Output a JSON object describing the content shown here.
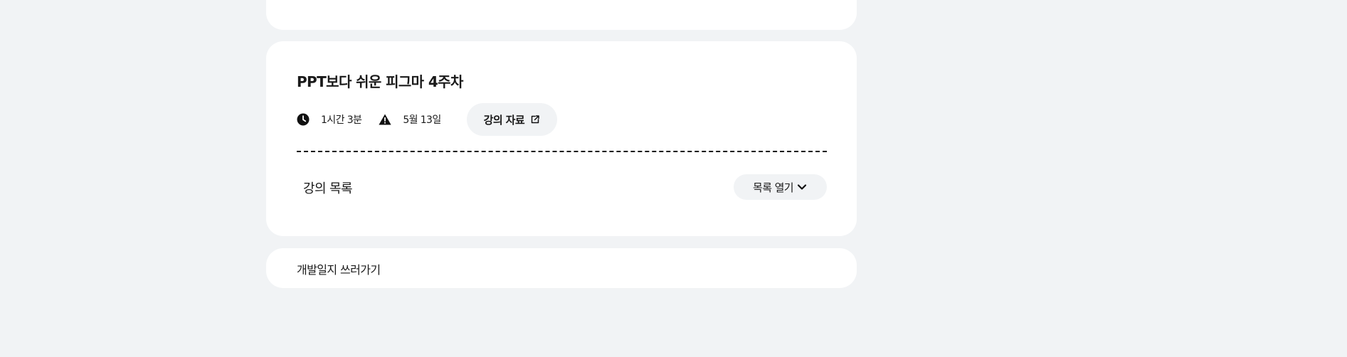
{
  "lecture": {
    "title": "PPT보다 쉬운 피그마 4주차",
    "duration": "1시간 3분",
    "date": "5월 13일",
    "materials_label": "강의 자료",
    "list_heading": "강의 목록",
    "list_toggle_label": "목록 열기"
  },
  "devlog": {
    "label": "개발일지 쓰러가기"
  },
  "icons": {
    "duration": "clock-icon",
    "date": "warning-icon",
    "materials": "external-link-icon",
    "toggle": "chevron-down-icon"
  },
  "colors": {
    "page_background": "#f1f3f5",
    "card_background": "#ffffff",
    "pill_background": "#f1f3f5",
    "text": "#1a1a1a"
  }
}
